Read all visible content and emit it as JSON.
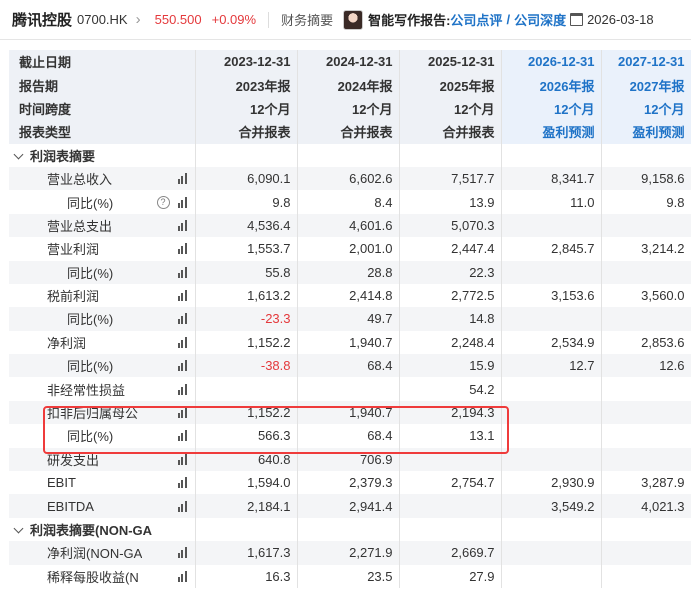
{
  "topbar": {
    "name": "腾讯控股",
    "code": "0700.HK",
    "chevron": "›",
    "price": "550.500",
    "change_pct": "+0.09%",
    "financial_summary": "财务摘要",
    "ai_label": "智能写作报告:",
    "link_review": "公司点评",
    "slash": "/",
    "link_depth": "公司深度",
    "date": "2026-03-18"
  },
  "header_rows": [
    {
      "label": "截止日期",
      "cells": [
        "2023-12-31",
        "2024-12-31",
        "2025-12-31",
        "2026-12-31",
        "2027-12-31"
      ]
    },
    {
      "label": "报告期",
      "cells": [
        "2023年报",
        "2024年报",
        "2025年报",
        "2026年报",
        "2027年报"
      ]
    },
    {
      "label": "时间跨度",
      "cells": [
        "12个月",
        "12个月",
        "12个月",
        "12个月",
        "12个月"
      ]
    },
    {
      "label": "报表类型",
      "cells": [
        "合并报表",
        "合并报表",
        "合并报表",
        "盈利预测",
        "盈利预测"
      ]
    }
  ],
  "sections": [
    {
      "title": "利润表摘要",
      "rows": [
        {
          "label": "营业总收入",
          "indent": 1,
          "help": false,
          "values": [
            "6,090.1",
            "6,602.6",
            "7,517.7",
            "8,341.7",
            "9,158.6"
          ]
        },
        {
          "label": "同比(%)",
          "indent": 2,
          "help": true,
          "help_glyph": "?",
          "values": [
            "9.8",
            "8.4",
            "13.9",
            "11.0",
            "9.8"
          ]
        },
        {
          "label": "营业总支出",
          "indent": 1,
          "help": false,
          "values": [
            "4,536.4",
            "4,601.6",
            "5,070.3",
            "",
            ""
          ]
        },
        {
          "label": "营业利润",
          "indent": 1,
          "help": false,
          "values": [
            "1,553.7",
            "2,001.0",
            "2,447.4",
            "2,845.7",
            "3,214.2"
          ]
        },
        {
          "label": "同比(%)",
          "indent": 2,
          "help": false,
          "values": [
            "55.8",
            "28.8",
            "22.3",
            "",
            ""
          ]
        },
        {
          "label": "税前利润",
          "indent": 1,
          "help": false,
          "values": [
            "1,613.2",
            "2,414.8",
            "2,772.5",
            "3,153.6",
            "3,560.0"
          ]
        },
        {
          "label": "同比(%)",
          "indent": 2,
          "help": false,
          "values": [
            "-23.3",
            "49.7",
            "14.8",
            "",
            ""
          ]
        },
        {
          "label": "净利润",
          "indent": 1,
          "help": false,
          "values": [
            "1,152.2",
            "1,940.7",
            "2,248.4",
            "2,534.9",
            "2,853.6"
          ]
        },
        {
          "label": "同比(%)",
          "indent": 2,
          "help": false,
          "values": [
            "-38.8",
            "68.4",
            "15.9",
            "12.7",
            "12.6"
          ]
        },
        {
          "label": "非经常性损益",
          "indent": 1,
          "help": false,
          "values": [
            "",
            "",
            "54.2",
            "",
            ""
          ]
        },
        {
          "label": "扣非后归属母公",
          "indent": 1,
          "help": false,
          "values": [
            "1,152.2",
            "1,940.7",
            "2,194.3",
            "",
            ""
          ]
        },
        {
          "label": "同比(%)",
          "indent": 2,
          "help": false,
          "values": [
            "566.3",
            "68.4",
            "13.1",
            "",
            ""
          ]
        },
        {
          "label": "研发支出",
          "indent": 1,
          "help": false,
          "values": [
            "640.8",
            "706.9",
            "",
            "",
            ""
          ]
        },
        {
          "label": "EBIT",
          "indent": 1,
          "help": false,
          "values": [
            "1,594.0",
            "2,379.3",
            "2,754.7",
            "2,930.9",
            "3,287.9"
          ]
        },
        {
          "label": "EBITDA",
          "indent": 1,
          "help": false,
          "values": [
            "2,184.1",
            "2,941.4",
            "",
            "3,549.2",
            "4,021.3"
          ]
        }
      ]
    },
    {
      "title": "利润表摘要(NON-GA",
      "rows": [
        {
          "label": "净利润(NON-GA",
          "indent": 1,
          "help": false,
          "values": [
            "1,617.3",
            "2,271.9",
            "2,669.7",
            "",
            ""
          ]
        },
        {
          "label": "稀释每股收益(N",
          "indent": 1,
          "help": false,
          "values": [
            "16.3",
            "23.5",
            "27.9",
            "",
            ""
          ]
        }
      ]
    }
  ],
  "colors": {
    "accent": "#1f73c7",
    "negative": "#e4393c",
    "highlight_box": "#ef3b3b",
    "header_bg": "#eef1f6"
  },
  "icons": {
    "row_chart": "bar-chart-icon",
    "help": "help-circle-icon",
    "collapse": "chevron-down-icon",
    "calendar": "calendar-icon",
    "avatar": "avatar"
  }
}
